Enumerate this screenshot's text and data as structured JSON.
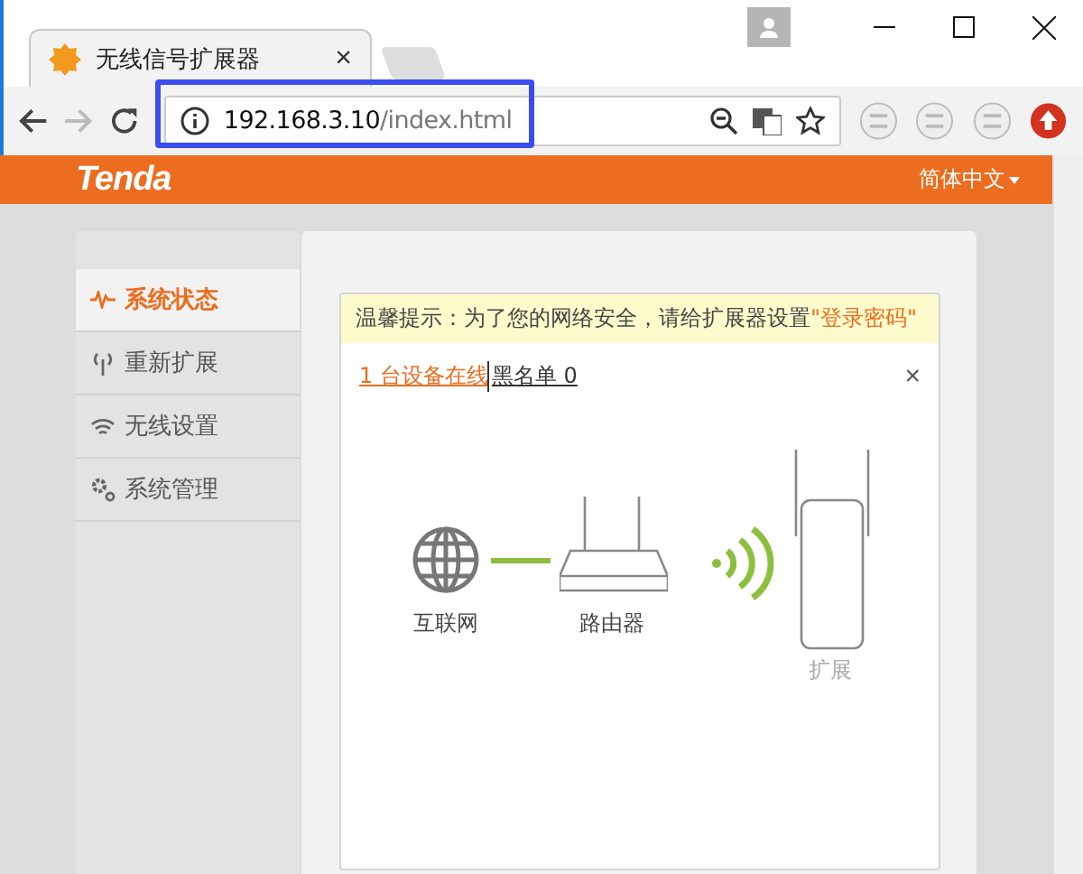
{
  "browser": {
    "tab_title": "无线信号扩展器",
    "tab_close": "×",
    "address_host": "192.168.3.10",
    "address_path": "/index.html"
  },
  "header": {
    "logo": "Tenda",
    "language": "简体中文"
  },
  "sidebar": {
    "items": [
      {
        "label": "系统状态",
        "kind": "status",
        "selected": true
      },
      {
        "label": "重新扩展",
        "kind": "antenna",
        "selected": false
      },
      {
        "label": "无线设置",
        "kind": "wifi",
        "selected": false
      },
      {
        "label": "系统管理",
        "kind": "gear",
        "selected": false
      }
    ]
  },
  "notice": {
    "text": "温馨提示：为了您的网络安全，请给扩展器设置 ",
    "link": "\"登录密码\""
  },
  "status": {
    "devices_online": "1 台设备在线",
    "blacklist": "黑名单 0",
    "close": "×"
  },
  "diagram": {
    "internet": "互联网",
    "router": "路由器",
    "extender": "扩展"
  }
}
